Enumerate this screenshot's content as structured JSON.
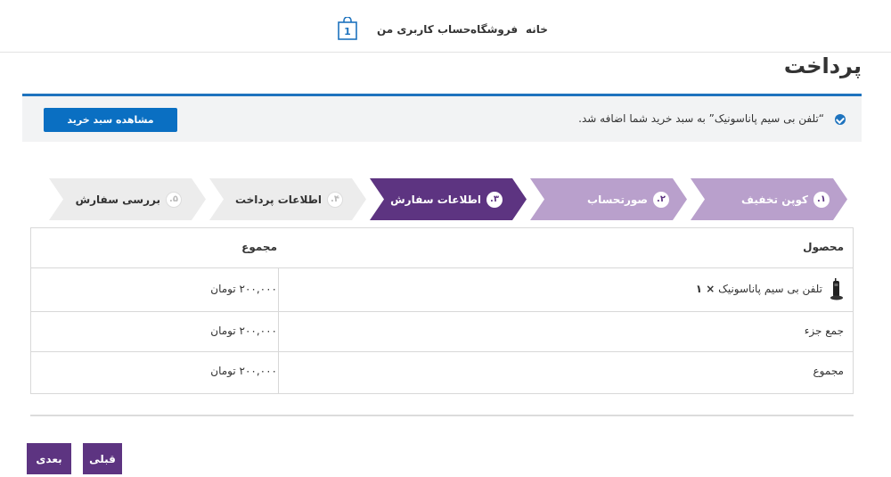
{
  "nav": {
    "home": "خانه",
    "shop": "فروشگاه",
    "account": "حساب کاربری من",
    "cart_count": "1"
  },
  "page": {
    "title": "پرداخت"
  },
  "notice": {
    "message": "“تلفن بی سیم پاناسونیک” به سبد خرید شما اضافه شد.",
    "button": "مشاهده سبد خرید"
  },
  "steps": [
    {
      "num": "۱.",
      "label": "کوپن تخفیف",
      "state": "completed"
    },
    {
      "num": "۲.",
      "label": "صورتحساب",
      "state": "completed"
    },
    {
      "num": "۳.",
      "label": "اطلاعات سفارش",
      "state": "active"
    },
    {
      "num": "۴.",
      "label": "اطلاعات پرداخت",
      "state": "upcoming"
    },
    {
      "num": "۵.",
      "label": "بررسی سفارش",
      "state": "upcoming"
    }
  ],
  "order": {
    "headers": {
      "product": "محصول",
      "total": "مجموع"
    },
    "item": {
      "name": "تلفن بی سیم پاناسونیک",
      "qty": "× ۱",
      "price": "۲۰۰,۰۰۰ تومان"
    },
    "subtotal": {
      "label": "جمع جزء",
      "value": "۲۰۰,۰۰۰ تومان"
    },
    "total": {
      "label": "مجموع",
      "value": "۲۰۰,۰۰۰ تومان"
    }
  },
  "buttons": {
    "prev": "قبلی",
    "next": "بعدی"
  },
  "colors": {
    "accent_blue": "#1e73be",
    "step_active": "#5d3481",
    "step_completed": "#b9a0cc",
    "step_upcoming": "#ececec"
  }
}
